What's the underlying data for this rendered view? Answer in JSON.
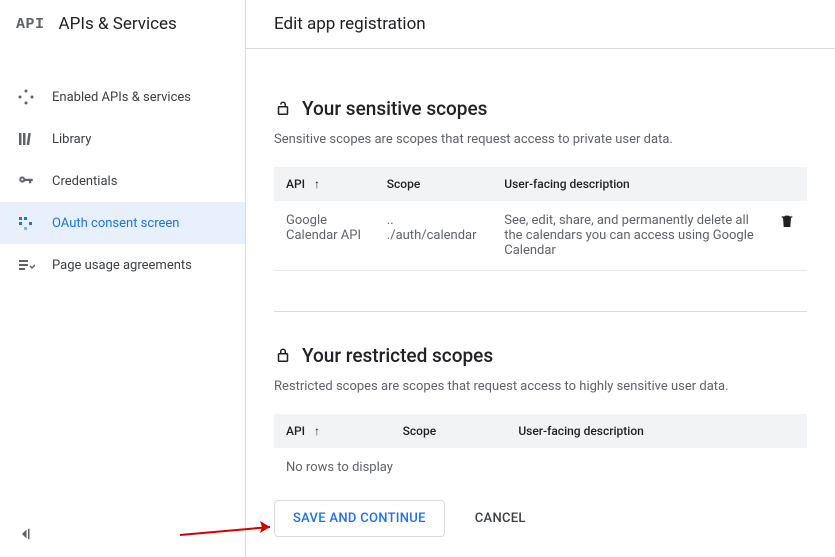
{
  "sidebar": {
    "logo": "API",
    "title": "APIs & Services",
    "items": [
      {
        "label": "Enabled APIs & services"
      },
      {
        "label": "Library"
      },
      {
        "label": "Credentials"
      },
      {
        "label": "OAuth consent screen"
      },
      {
        "label": "Page usage agreements"
      }
    ]
  },
  "header": {
    "title": "Edit app registration"
  },
  "sensitive": {
    "title": "Your sensitive scopes",
    "description": "Sensitive scopes are scopes that request access to private user data.",
    "columns": {
      "api": "API",
      "scope": "Scope",
      "desc": "User-facing description"
    },
    "row": {
      "api": "Google Calendar API",
      "scope": ".. ./auth/calendar",
      "desc": "See, edit, share, and permanently delete all the calendars you can access using Google Calendar"
    }
  },
  "restricted": {
    "title": "Your restricted scopes",
    "description": "Restricted scopes are scopes that request access to highly sensitive user data.",
    "columns": {
      "api": "API",
      "scope": "Scope",
      "desc": "User-facing description"
    },
    "empty": "No rows to display"
  },
  "actions": {
    "save": "SAVE AND CONTINUE",
    "cancel": "CANCEL"
  }
}
